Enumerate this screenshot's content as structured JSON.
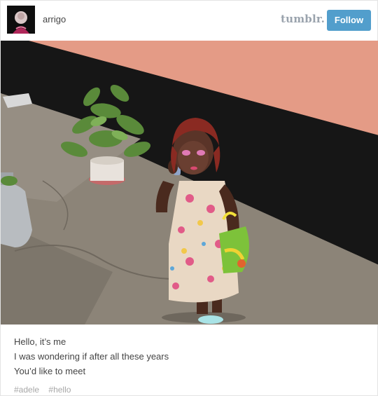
{
  "header": {
    "username": "arrigo",
    "brand": "tumblr.",
    "follow_label": "Follow"
  },
  "post": {
    "caption_lines": [
      "Hello, it’s me",
      "I was wondering if after all these years",
      "You’d like to meet"
    ],
    "tags": [
      "#adele",
      "#hello"
    ]
  },
  "colors": {
    "follow_button": "#529ecc",
    "brand_text": "#9aa3ad",
    "tag_text": "#a7a7a7"
  },
  "icons": [
    "avatar-image"
  ]
}
